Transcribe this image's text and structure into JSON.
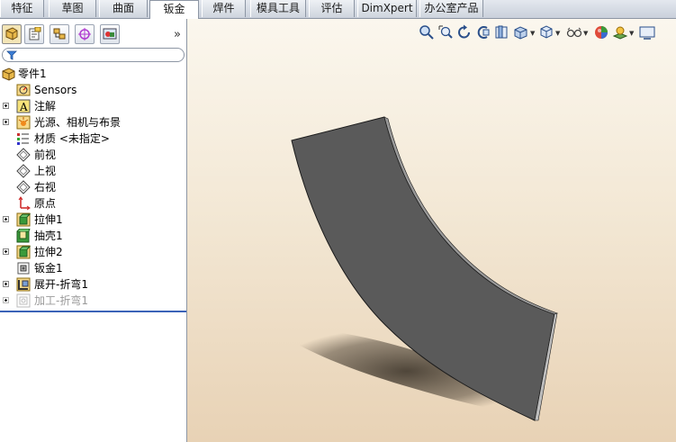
{
  "command_tabs": [
    "特征",
    "草图",
    "曲面",
    "钣金",
    "焊件",
    "模具工具",
    "评估",
    "DimXpert",
    "办公室产品"
  ],
  "active_tab": "钣金",
  "panel": {
    "collapse_glyph": "»",
    "tabs": [
      "featuremanager-tab",
      "propertymanager-tab",
      "configurationmanager-tab",
      "dimxpertmanager-tab",
      "display-manager-tab"
    ]
  },
  "tree": {
    "root": "零件1",
    "items": [
      {
        "label": "Sensors",
        "icon": "sensors-icon",
        "expandable": false
      },
      {
        "label": "注解",
        "icon": "annotations-icon",
        "expandable": true
      },
      {
        "label": "光源、相机与布景",
        "icon": "lights-cameras-icon",
        "expandable": true
      },
      {
        "label": "材质 <未指定>",
        "icon": "material-icon",
        "expandable": false
      },
      {
        "label": "前视",
        "icon": "plane-icon",
        "expandable": false
      },
      {
        "label": "上视",
        "icon": "plane-icon",
        "expandable": false
      },
      {
        "label": "右视",
        "icon": "plane-icon",
        "expandable": false
      },
      {
        "label": "原点",
        "icon": "origin-icon",
        "expandable": false
      },
      {
        "label": "拉伸1",
        "icon": "extrude-icon",
        "expandable": true
      },
      {
        "label": "抽壳1",
        "icon": "shell-icon",
        "expandable": false
      },
      {
        "label": "拉伸2",
        "icon": "extrude-icon",
        "expandable": true
      },
      {
        "label": "钣金1",
        "icon": "sheetmetal-icon",
        "expandable": false
      },
      {
        "label": "展开-折弯1",
        "icon": "flatten-bends-icon",
        "expandable": true
      },
      {
        "label": "加工-折弯1",
        "icon": "process-bends-icon",
        "expandable": true,
        "suppressed": true
      }
    ]
  },
  "colors": {
    "tabbar": "#c9d0db",
    "part_face": "#5a5a5a",
    "rollback_bar": "#3b63b8",
    "background_top": "#fbf7ee",
    "background_bottom": "#e8d2b5"
  }
}
